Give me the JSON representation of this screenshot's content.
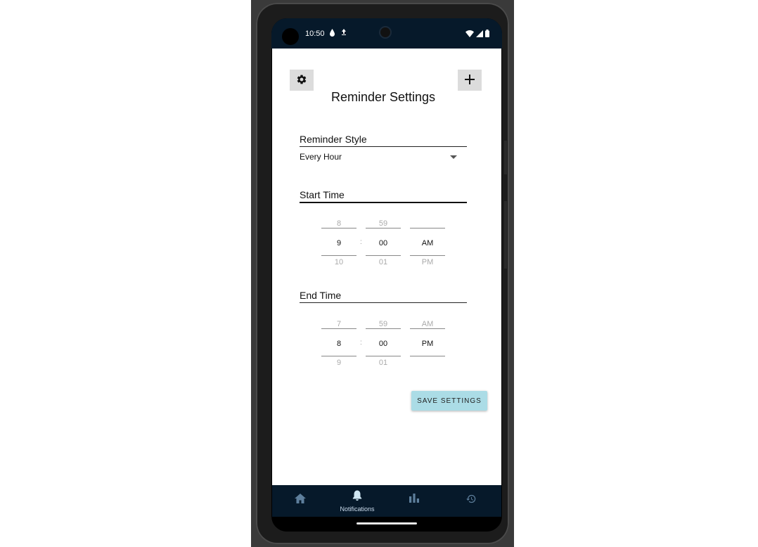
{
  "status_bar": {
    "time": "10:50"
  },
  "screen": {
    "title": "Reminder Settings",
    "reminder_style": {
      "label": "Reminder Style",
      "selected": "Every Hour"
    },
    "start_time": {
      "label": "Start Time",
      "hour": {
        "prev": "8",
        "current": "9",
        "next": "10"
      },
      "minute": {
        "prev": "59",
        "current": "00",
        "next": "01"
      },
      "ampm": {
        "prev": "",
        "current": "AM",
        "next": "PM"
      },
      "separator": ":"
    },
    "end_time": {
      "label": "End Time",
      "hour": {
        "prev": "7",
        "current": "8",
        "next": "9"
      },
      "minute": {
        "prev": "59",
        "current": "00",
        "next": "01"
      },
      "ampm": {
        "prev": "AM",
        "current": "PM",
        "next": ""
      },
      "separator": ":"
    },
    "save_button_label": "SAVE SETTINGS"
  },
  "bottom_nav": {
    "items": [
      {
        "icon": "home-icon",
        "label": ""
      },
      {
        "icon": "bell-icon",
        "label": "Notifications",
        "active": true
      },
      {
        "icon": "bar-chart-icon",
        "label": ""
      },
      {
        "icon": "history-icon",
        "label": ""
      }
    ]
  },
  "colors": {
    "status_bar_bg": "#06192a",
    "nav_bg": "#06192a",
    "save_button_bg": "#abdce6",
    "icon_button_bg": "#dcdcdc"
  }
}
